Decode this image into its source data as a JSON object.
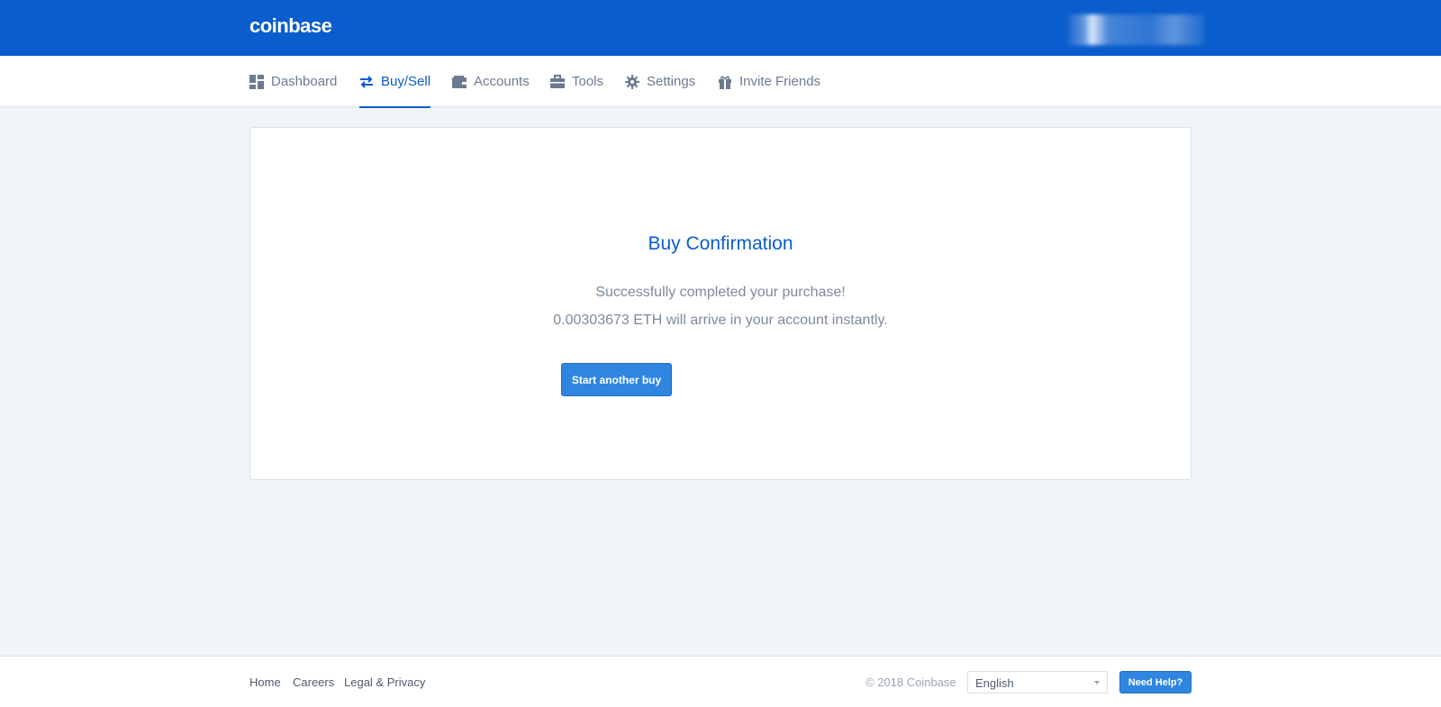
{
  "header": {
    "logo": "coinbase"
  },
  "nav": {
    "items": [
      {
        "label": "Dashboard",
        "icon": "dashboard-icon"
      },
      {
        "label": "Buy/Sell",
        "icon": "exchange-icon",
        "active": true
      },
      {
        "label": "Accounts",
        "icon": "wallet-icon"
      },
      {
        "label": "Tools",
        "icon": "briefcase-icon"
      },
      {
        "label": "Settings",
        "icon": "gear-icon"
      },
      {
        "label": "Invite Friends",
        "icon": "gift-icon"
      }
    ]
  },
  "confirmation": {
    "title": "Buy Confirmation",
    "message_line1": "Successfully completed your purchase!",
    "message_line2": "0.00303673 ETH will arrive in your account instantly.",
    "start_button": "Start another buy"
  },
  "footer": {
    "links": [
      "Home",
      "Careers",
      "Legal & Privacy"
    ],
    "copyright": "© 2018 Coinbase",
    "language": "English",
    "help_button": "Need Help?"
  },
  "colors": {
    "brand": "#0a5dcc",
    "button": "#2f85e0",
    "background": "#f2f5f8"
  }
}
